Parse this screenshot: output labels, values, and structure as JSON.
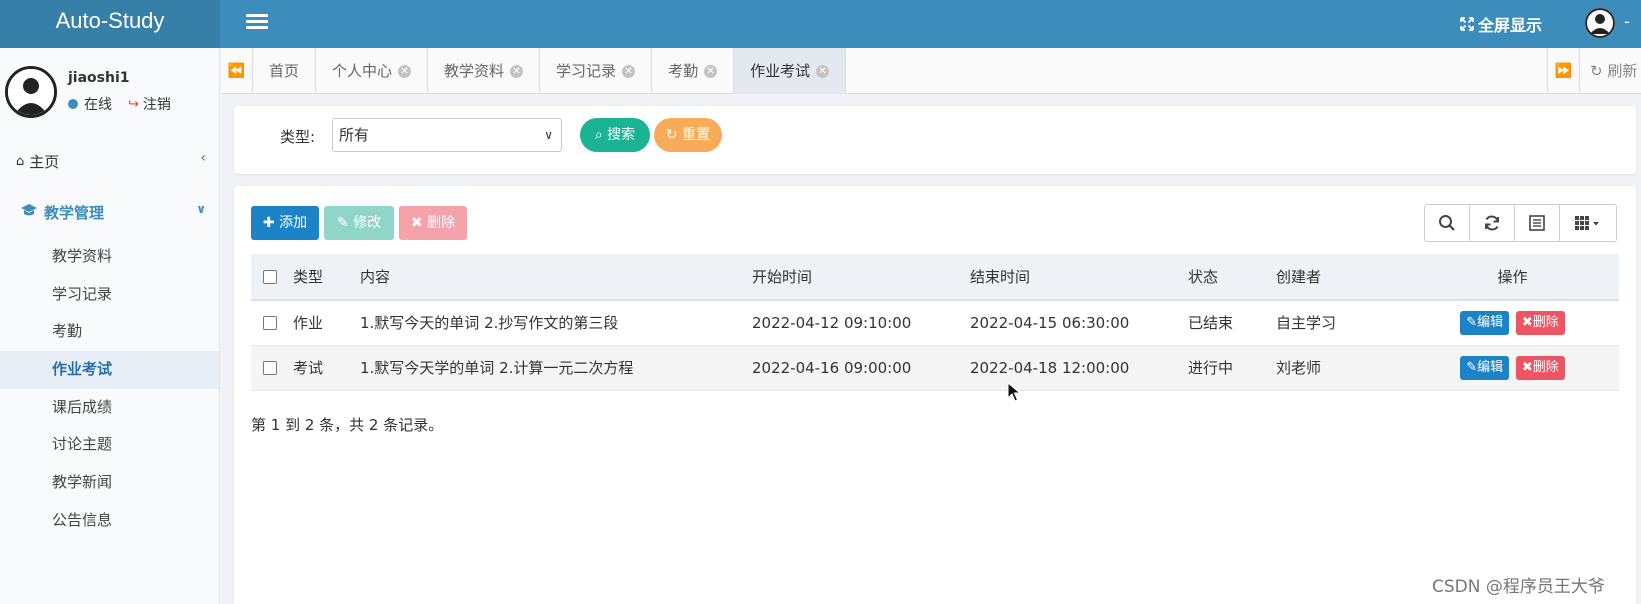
{
  "header": {
    "brand": "Auto-Study",
    "fullscreen_label": "全屏显示",
    "user_menu_suffix": "-"
  },
  "sidebar": {
    "username": "jiaoshi1",
    "status_online": "在线",
    "logout": "注销",
    "home_label": "主页",
    "group_label": "教学管理",
    "items": [
      {
        "label": "教学资料"
      },
      {
        "label": "学习记录"
      },
      {
        "label": "考勤"
      },
      {
        "label": "作业考试"
      },
      {
        "label": "课后成绩"
      },
      {
        "label": "讨论主题"
      },
      {
        "label": "教学新闻"
      },
      {
        "label": "公告信息"
      }
    ],
    "active_item": "作业考试"
  },
  "tabs": {
    "items": [
      {
        "label": "首页",
        "closable": false
      },
      {
        "label": "个人中心",
        "closable": true
      },
      {
        "label": "教学资料",
        "closable": true
      },
      {
        "label": "学习记录",
        "closable": true
      },
      {
        "label": "考勤",
        "closable": true
      },
      {
        "label": "作业考试",
        "closable": true
      }
    ],
    "active": "作业考试",
    "refresh_label": "刷新"
  },
  "search": {
    "type_label": "类型:",
    "type_value": "所有",
    "search_btn": "搜索",
    "reset_btn": "重置"
  },
  "toolbar": {
    "add_label": "添加",
    "edit_label": "修改",
    "delete_label": "删除"
  },
  "table": {
    "columns": [
      "类型",
      "内容",
      "开始时间",
      "结束时间",
      "状态",
      "创建者",
      "操作"
    ],
    "rows": [
      {
        "type": "作业",
        "content": "1.默写今天的单词 2.抄写作文的第三段",
        "start": "2022-04-12 09:10:00",
        "end": "2022-04-15 06:30:00",
        "status": "已结束",
        "creator": "自主学习"
      },
      {
        "type": "考试",
        "content": "1.默写今天学的单词 2.计算一元二次方程",
        "start": "2022-04-16 09:00:00",
        "end": "2022-04-18 12:00:00",
        "status": "进行中",
        "creator": "刘老师"
      }
    ],
    "row_edit": "编辑",
    "row_delete": "删除"
  },
  "pagination_info": "第 1 到 2 条，共 2 条记录。",
  "watermark": "CSDN @程序员王大爷",
  "colors": {
    "header": "#3c8dbc",
    "brand_bg": "#367fa9",
    "primary": "#1c84c6",
    "success": "#1ab394",
    "warning": "#f8ac59",
    "danger": "#ed5565"
  }
}
